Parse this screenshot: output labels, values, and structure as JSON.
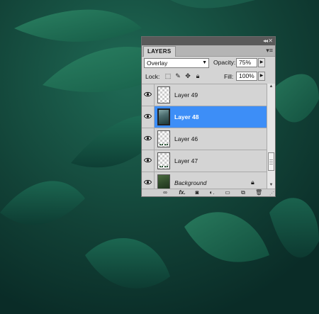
{
  "panel": {
    "tab_label": "LAYERS",
    "blend_mode": "Overlay",
    "opacity_label": "Opacity:",
    "opacity_value": "75%",
    "lock_label": "Lock:",
    "fill_label": "Fill:",
    "fill_value": "100%"
  },
  "layers": [
    {
      "name": "Layer 49",
      "visible": true,
      "selected": false,
      "thumb": "transparent"
    },
    {
      "name": "Layer 48",
      "visible": true,
      "selected": true,
      "thumb": "photo"
    },
    {
      "name": "Layer 46",
      "visible": true,
      "selected": false,
      "thumb": "transparent-sprig"
    },
    {
      "name": "Layer 47",
      "visible": true,
      "selected": false,
      "thumb": "transparent-sprig"
    },
    {
      "name": "Background",
      "visible": true,
      "selected": false,
      "thumb": "image",
      "locked": true
    }
  ],
  "bottom_icons": [
    "link-layers-icon",
    "fx-icon",
    "layer-mask-icon",
    "adjustment-layer-icon",
    "new-group-icon",
    "new-layer-icon",
    "delete-layer-icon"
  ],
  "colors": {
    "selected_row": "#3d8ef7",
    "panel_bg": "#d4d4d4",
    "canvas_bg": "#0f3b34"
  }
}
